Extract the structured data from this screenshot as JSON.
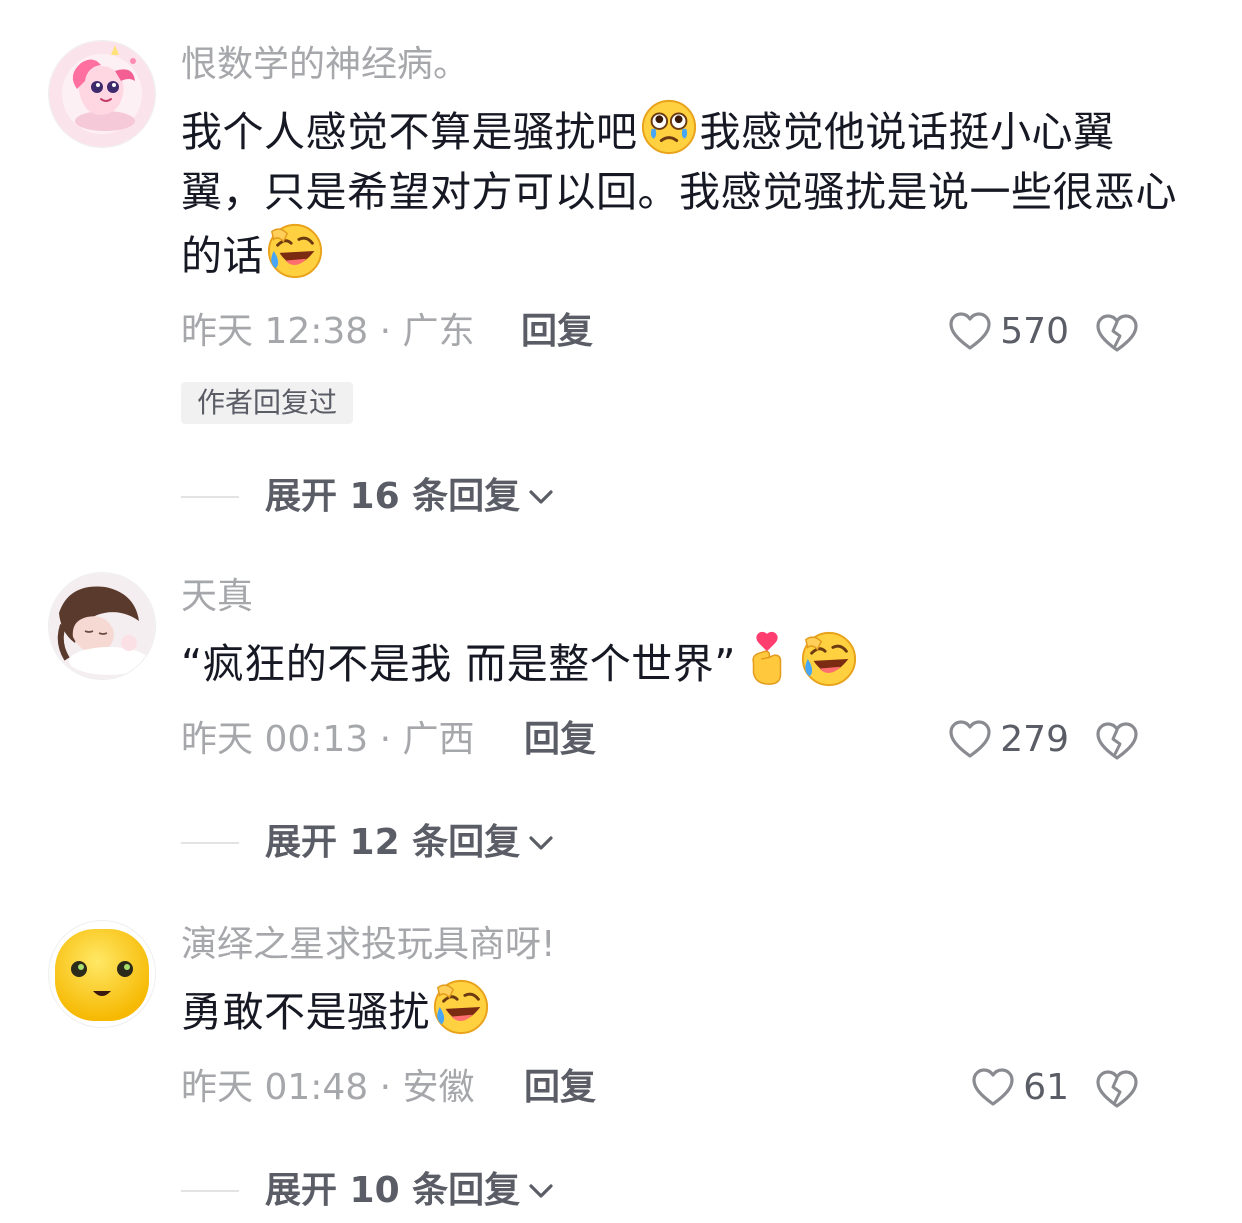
{
  "comments": [
    {
      "username": "恨数学的神经病。",
      "avatar_icon": "pink-pony-avatar",
      "content_parts": [
        "我个人感觉不算是骚扰吧",
        "我感觉他说话挺小心翼翼，只是希望对方可以回。我感觉骚扰是说一些很恶心的话"
      ],
      "emojis": [
        "teary-eyed-emoji",
        "laugh-cry-emoji"
      ],
      "time_location": "昨天 12:38 · 广东",
      "reply_label": "回复",
      "likes": "570",
      "author_tag": "作者回复过",
      "expand_label": "展开 16 条回复"
    },
    {
      "username": "天真",
      "avatar_icon": "sleeping-girl-avatar",
      "content_parts": [
        "“疯狂的不是我 而是整个世界”"
      ],
      "emojis": [
        "finger-heart-emoji",
        "laugh-cry-emoji"
      ],
      "time_location": "昨天 00:13 · 广西",
      "reply_label": "回复",
      "likes": "279",
      "expand_label": "展开 12 条回复"
    },
    {
      "username": "演绎之星求投玩具商呀!",
      "avatar_icon": "yellow-smiley-avatar",
      "content_parts": [
        "勇敢不是骚扰"
      ],
      "emojis": [
        "laugh-cry-emoji"
      ],
      "time_location": "昨天 01:48 · 安徽",
      "reply_label": "回复",
      "likes": "61",
      "expand_label": "展开 10 条回复"
    }
  ],
  "colors": {
    "username": "#a6a7ab",
    "content": "#161823",
    "secondary": "#5b5d66",
    "tag_bg": "#f1f1f2",
    "divider": "#e3e3e4"
  }
}
